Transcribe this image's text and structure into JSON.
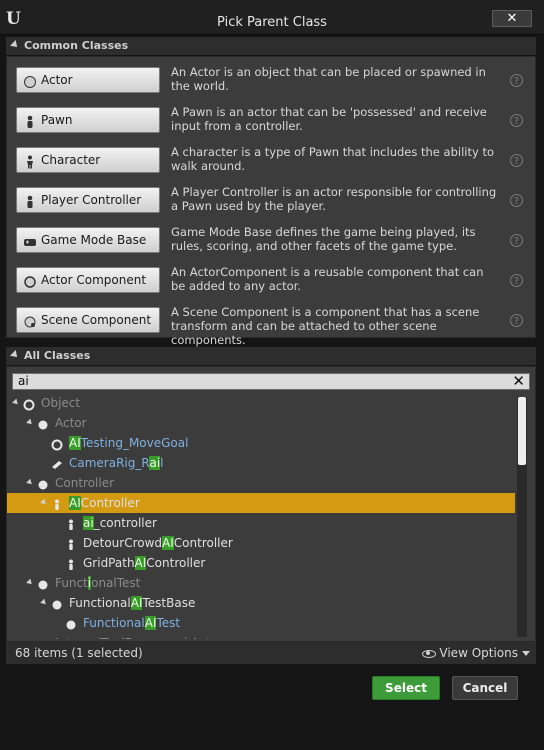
{
  "window": {
    "title": "Pick Parent Class",
    "close_label": "✕"
  },
  "common": {
    "header": "Common Classes",
    "classes": [
      {
        "label": "Actor",
        "icon": "sphere-icon",
        "desc": "An Actor is an object that can be placed or spawned in the world."
      },
      {
        "label": "Pawn",
        "icon": "pawn-icon",
        "desc": "A Pawn is an actor that can be 'possessed' and receive input from a controller."
      },
      {
        "label": "Character",
        "icon": "character-icon",
        "desc": "A character is a type of Pawn that includes the ability to walk around."
      },
      {
        "label": "Player Controller",
        "icon": "controller-icon",
        "desc": "A Player Controller is an actor responsible for controlling a Pawn used by the player."
      },
      {
        "label": "Game Mode Base",
        "icon": "game-mode-icon",
        "desc": "Game Mode Base defines the game being played, its rules, scoring, and other facets of the game type."
      },
      {
        "label": "Actor Component",
        "icon": "actor-component-icon",
        "desc": "An ActorComponent is a reusable component that can be added to any actor."
      },
      {
        "label": "Scene Component",
        "icon": "scene-component-icon",
        "desc": "A Scene Component is a component that has a scene transform and can be attached to other scene components."
      }
    ]
  },
  "all": {
    "header": "All Classes",
    "search_value": "ai",
    "tree": [
      {
        "pre": "Object",
        "hl": "",
        "post": "",
        "style": "dim",
        "expanded": true
      },
      {
        "pre": "Actor",
        "hl": "",
        "post": "",
        "style": "dim",
        "expanded": true
      },
      {
        "pre": "",
        "hl": "AI",
        "post": "Testing_MoveGoal",
        "style": "link",
        "expanded": false
      },
      {
        "pre": "CameraRig_R",
        "hl": "ai",
        "post": "l",
        "style": "link",
        "expanded": false
      },
      {
        "pre": "Controller",
        "hl": "",
        "post": "",
        "style": "dim",
        "expanded": true
      },
      {
        "pre": "",
        "hl": "AI",
        "post": "Controller",
        "style": "selected",
        "expanded": true
      },
      {
        "pre": "",
        "hl": "ai",
        "post": "_controller",
        "style": "normal",
        "expanded": false
      },
      {
        "pre": "DetourCrowd",
        "hl": "AI",
        "post": "Controller",
        "style": "normal",
        "expanded": false
      },
      {
        "pre": "GridPath",
        "hl": "AI",
        "post": "Controller",
        "style": "normal",
        "expanded": false
      },
      {
        "pre": "Funct",
        "hl": "i",
        "post": "onalTest",
        "style": "dim",
        "expanded": true
      },
      {
        "pre": "Functional",
        "hl": "AI",
        "post": "TestBase",
        "style": "normal",
        "expanded": true
      },
      {
        "pre": "Functional",
        "hl": "AI",
        "post": "Test",
        "style": "link",
        "expanded": false
      },
      {
        "pre": "InternalToolFrameworkActor",
        "hl": "",
        "post": "",
        "style": "dim",
        "expanded": true
      }
    ]
  },
  "status": {
    "items": "68 items (1 selected)",
    "view_options": "View Options"
  },
  "footer": {
    "select": "Select",
    "cancel": "Cancel"
  },
  "colors": {
    "selected_row": "#d39a12",
    "highlight": "#3a9b2a",
    "select_button": "#3d9b3a"
  }
}
